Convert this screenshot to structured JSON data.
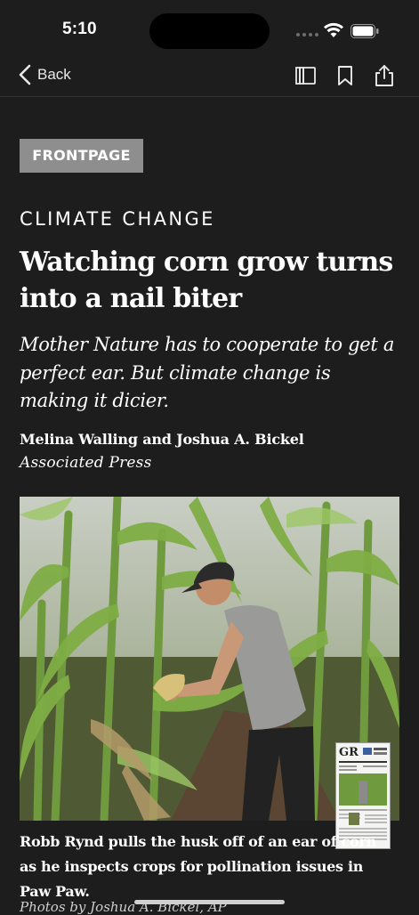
{
  "status_bar": {
    "time": "5:10"
  },
  "nav": {
    "back_label": "Back"
  },
  "article": {
    "section_tag": "FRONTPAGE",
    "kicker": "CLIMATE CHANGE",
    "headline_line1": "Watching corn grow turns",
    "headline_line2": "into a nail biter",
    "dek_line1": "Mother Nature has to cooperate to get a",
    "dek_line2": "perfect ear. But climate change is",
    "dek_line3": "making it dicier.",
    "byline": "Melina Walling and Joshua A. Bickel",
    "source": "Associated Press",
    "caption_line1": "Robb Rynd pulls the husk off of an ear of corn",
    "caption_line2": "as he inspects crops for pollination issues in",
    "caption_line3": "Paw Paw.",
    "photo_credit": "Photos by Joshua A. Bickel, AP"
  },
  "thumbnail": {
    "masthead": "GR"
  },
  "colors": {
    "background": "#1d1d1d",
    "tag_bg": "#8e8e8e",
    "text": "#ffffff"
  }
}
